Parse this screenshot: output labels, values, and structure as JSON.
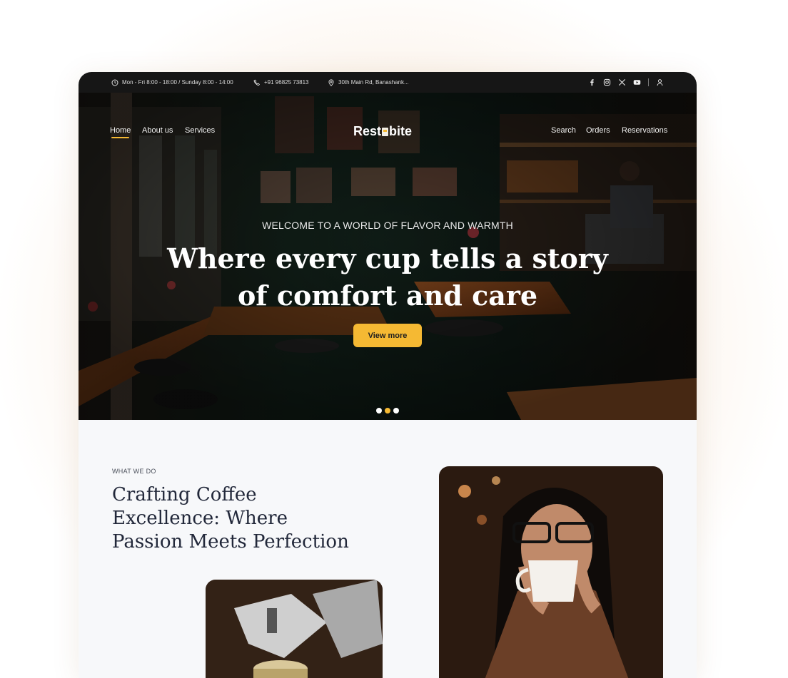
{
  "topbar": {
    "hours": "Mon - Fri 8:00 - 18:00 / Sunday 8:00 - 14:00",
    "phone": "+91 96825 73813",
    "address": "30th Main Rd, Banashank..."
  },
  "nav": {
    "left": [
      "Home",
      "About us",
      "Services"
    ],
    "brand_prefix": "Rest",
    "brand_suffix": "bite",
    "right": [
      "Search",
      "Orders",
      "Reservations"
    ]
  },
  "hero": {
    "eyebrow": "WELCOME TO A WORLD OF FLAVOR AND WARMTH",
    "headline_line1": "Where every cup tells a story",
    "headline_line2": "of comfort and care",
    "cta": "View more",
    "slides_total": 3,
    "slide_active": 2
  },
  "section": {
    "kicker": "WHAT WE DO",
    "title_line1": "Crafting Coffee",
    "title_line2": "Excellence: Where",
    "title_line3": "Passion Meets Perfection"
  },
  "colors": {
    "accent": "#f5b933",
    "topbar_bg": "#161616",
    "heading": "#22283a"
  }
}
